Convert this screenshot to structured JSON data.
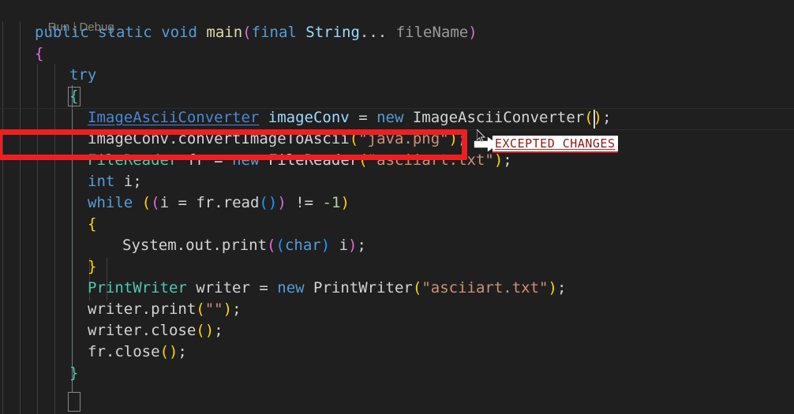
{
  "editor": {
    "background": "#1f1f1f",
    "foreground": "#d4d4d4",
    "codelens": {
      "run_label": "Run",
      "separator": "|",
      "debug_label": "Debug"
    },
    "lines": [
      {
        "id": "signature",
        "indent": 44,
        "tokens": [
          {
            "t": "public",
            "c": "kw"
          },
          {
            "t": " ",
            "c": "pln"
          },
          {
            "t": "static",
            "c": "kw"
          },
          {
            "t": " ",
            "c": "pln"
          },
          {
            "t": "void",
            "c": "kw"
          },
          {
            "t": " ",
            "c": "pln"
          },
          {
            "t": "main",
            "c": "fn"
          },
          {
            "t": "(",
            "c": "b2"
          },
          {
            "t": "final",
            "c": "kw"
          },
          {
            "t": " ",
            "c": "pln"
          },
          {
            "t": "String",
            "c": "var"
          },
          {
            "t": "... ",
            "c": "pln"
          },
          {
            "t": "fileName",
            "c": "prm"
          },
          {
            "t": ")",
            "c": "b2"
          }
        ]
      },
      {
        "id": "open-brace-method",
        "indent": 44,
        "tokens": [
          {
            "t": "{",
            "c": "b2"
          }
        ]
      },
      {
        "id": "try-keyword",
        "indent": 88,
        "tokens": [
          {
            "t": "try",
            "c": "kw"
          }
        ]
      },
      {
        "id": "open-brace-try",
        "indent": 88,
        "tokens": [
          {
            "t": "{",
            "c": "typ"
          }
        ]
      },
      {
        "id": "declare-converter",
        "indent": 111,
        "tokens": [
          {
            "t": "ImageAsciiConverter",
            "c": "link"
          },
          {
            "t": " ",
            "c": "pln"
          },
          {
            "t": "imageConv",
            "c": "var"
          },
          {
            "t": " = ",
            "c": "pln"
          },
          {
            "t": "new",
            "c": "kw"
          },
          {
            "t": " ",
            "c": "pln"
          },
          {
            "t": "ImageAsciiConverter",
            "c": "pln"
          },
          {
            "t": "(",
            "c": "b1"
          },
          {
            "t": ")",
            "c": "b1"
          },
          {
            "t": ";",
            "c": "pln"
          }
        ]
      },
      {
        "id": "convert-call",
        "indent": 111,
        "tokens": [
          {
            "t": "imageConv",
            "c": "pln"
          },
          {
            "t": ".convertImageToAscii",
            "c": "pln"
          },
          {
            "t": "(",
            "c": "b1"
          },
          {
            "t": "\"java.png\"",
            "c": "str"
          },
          {
            "t": ")",
            "c": "b1"
          },
          {
            "t": ";",
            "c": "pln"
          }
        ]
      },
      {
        "id": "declare-filereader",
        "indent": 111,
        "tokens": [
          {
            "t": "FileReader",
            "c": "typ"
          },
          {
            "t": " ",
            "c": "pln"
          },
          {
            "t": "fr",
            "c": "pln"
          },
          {
            "t": " = ",
            "c": "pln"
          },
          {
            "t": "new",
            "c": "kw"
          },
          {
            "t": " ",
            "c": "pln"
          },
          {
            "t": "FileReader",
            "c": "pln"
          },
          {
            "t": "(",
            "c": "b1"
          },
          {
            "t": "\"asciiart.txt\"",
            "c": "str"
          },
          {
            "t": ")",
            "c": "b1"
          },
          {
            "t": ";",
            "c": "pln"
          }
        ]
      },
      {
        "id": "declare-int-i",
        "indent": 111,
        "tokens": [
          {
            "t": "int",
            "c": "kw"
          },
          {
            "t": " i;",
            "c": "pln"
          }
        ]
      },
      {
        "id": "while-condition",
        "indent": 111,
        "tokens": [
          {
            "t": "while",
            "c": "kw"
          },
          {
            "t": " ",
            "c": "pln"
          },
          {
            "t": "(",
            "c": "b1"
          },
          {
            "t": "(",
            "c": "b2"
          },
          {
            "t": "i",
            "c": "pln"
          },
          {
            "t": " = ",
            "c": "pln"
          },
          {
            "t": "fr.read",
            "c": "pln"
          },
          {
            "t": "(",
            "c": "b3"
          },
          {
            "t": ")",
            "c": "b3"
          },
          {
            "t": ")",
            "c": "b2"
          },
          {
            "t": " != ",
            "c": "pln"
          },
          {
            "t": "-1",
            "c": "num"
          },
          {
            "t": ")",
            "c": "b1"
          }
        ]
      },
      {
        "id": "open-brace-while",
        "indent": 111,
        "tokens": [
          {
            "t": "{",
            "c": "b1"
          }
        ]
      },
      {
        "id": "print-char",
        "indent": 155,
        "tokens": [
          {
            "t": "System.out.print",
            "c": "pln"
          },
          {
            "t": "(",
            "c": "b2"
          },
          {
            "t": "(",
            "c": "b3"
          },
          {
            "t": "char",
            "c": "kw"
          },
          {
            "t": ")",
            "c": "b3"
          },
          {
            "t": " i",
            "c": "pln"
          },
          {
            "t": ")",
            "c": "b2"
          },
          {
            "t": ";",
            "c": "pln"
          }
        ]
      },
      {
        "id": "close-brace-while",
        "indent": 111,
        "tokens": [
          {
            "t": "}",
            "c": "b1"
          }
        ]
      },
      {
        "id": "declare-printwriter",
        "indent": 111,
        "tokens": [
          {
            "t": "PrintWriter",
            "c": "typ"
          },
          {
            "t": " ",
            "c": "pln"
          },
          {
            "t": "writer",
            "c": "pln"
          },
          {
            "t": " = ",
            "c": "pln"
          },
          {
            "t": "new",
            "c": "kw"
          },
          {
            "t": " ",
            "c": "pln"
          },
          {
            "t": "PrintWriter",
            "c": "pln"
          },
          {
            "t": "(",
            "c": "b1"
          },
          {
            "t": "\"asciiart.txt\"",
            "c": "str"
          },
          {
            "t": ")",
            "c": "b1"
          },
          {
            "t": ";",
            "c": "pln"
          }
        ]
      },
      {
        "id": "writer-print",
        "indent": 111,
        "tokens": [
          {
            "t": "writer.print",
            "c": "pln"
          },
          {
            "t": "(",
            "c": "b1"
          },
          {
            "t": "\"\"",
            "c": "str"
          },
          {
            "t": ")",
            "c": "b1"
          },
          {
            "t": ";",
            "c": "pln"
          }
        ]
      },
      {
        "id": "writer-close",
        "indent": 111,
        "tokens": [
          {
            "t": "writer.close",
            "c": "pln"
          },
          {
            "t": "(",
            "c": "b1"
          },
          {
            "t": ")",
            "c": "b1"
          },
          {
            "t": ";",
            "c": "pln"
          }
        ]
      },
      {
        "id": "fr-close",
        "indent": 111,
        "tokens": [
          {
            "t": "fr.close",
            "c": "pln"
          },
          {
            "t": "(",
            "c": "b1"
          },
          {
            "t": ")",
            "c": "b1"
          },
          {
            "t": ";",
            "c": "pln"
          }
        ]
      },
      {
        "id": "close-brace-try",
        "indent": 88,
        "tokens": [
          {
            "t": "}",
            "c": "typ"
          }
        ]
      }
    ]
  },
  "annotation": {
    "highlight_color": "#f01f1f",
    "callout_text": "EXCEPTED CHANGES",
    "callout_text_color": "#8d1a1a",
    "callout_background": "#ffffff",
    "arrow_icon": "arrow-right-outline-icon"
  }
}
